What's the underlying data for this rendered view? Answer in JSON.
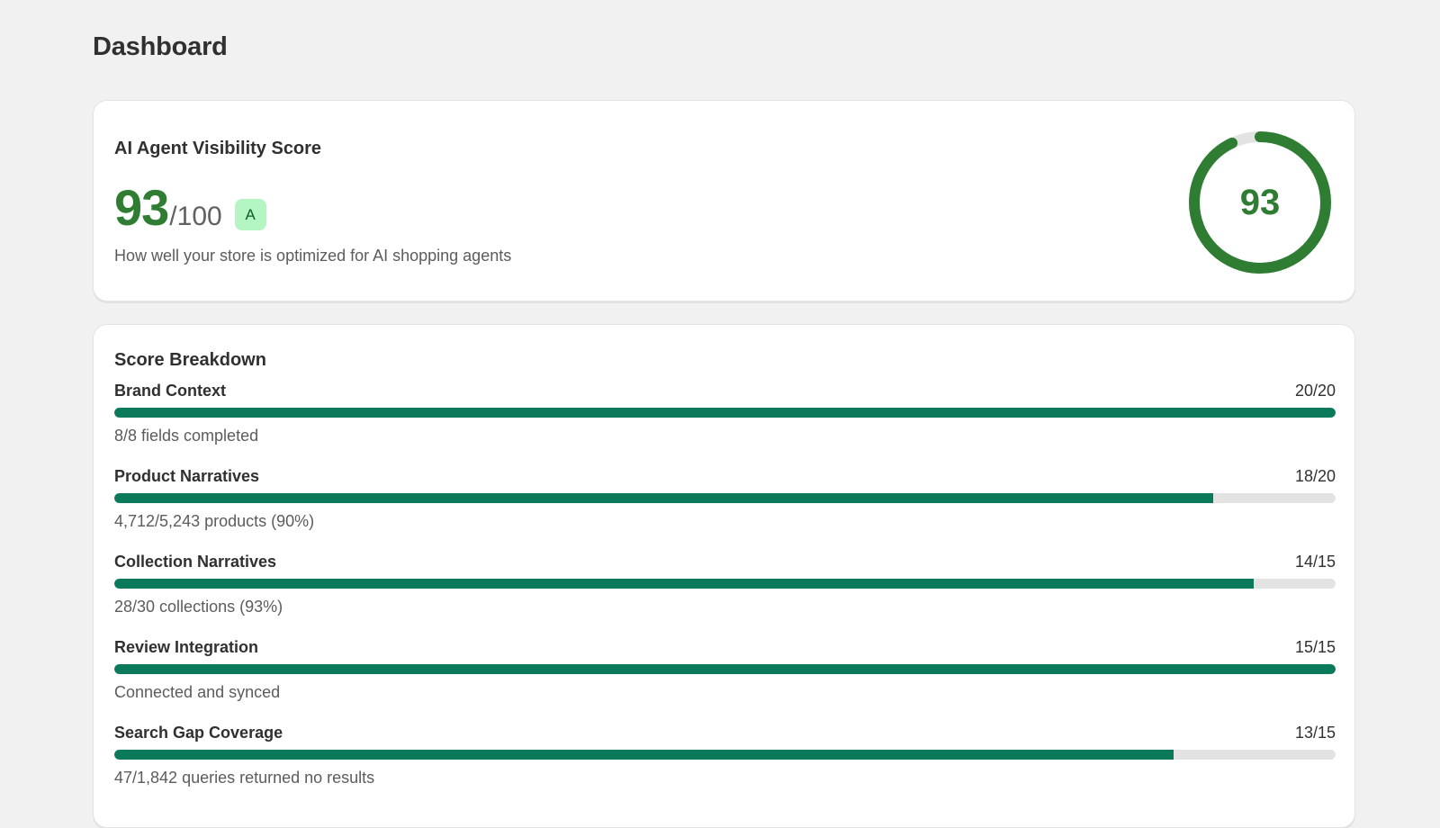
{
  "page": {
    "title": "Dashboard"
  },
  "score_card": {
    "title": "AI Agent Visibility Score",
    "score": "93",
    "max": "/100",
    "grade": "A",
    "description": "How well your store is optimized for AI shopping agents",
    "ring_label": "93",
    "ring_fraction": 0.93,
    "colors": {
      "accent": "#2e7d32",
      "track": "#e3e3e3",
      "badge_bg": "#b4f5c4"
    }
  },
  "breakdown": {
    "title": "Score Breakdown",
    "bar_color": "#0b7a5a",
    "metrics": [
      {
        "name": "Brand Context",
        "score": "20/20",
        "fraction": 1.0,
        "detail": "8/8 fields completed"
      },
      {
        "name": "Product Narratives",
        "score": "18/20",
        "fraction": 0.9,
        "detail": "4,712/5,243 products (90%)"
      },
      {
        "name": "Collection Narratives",
        "score": "14/15",
        "fraction": 0.933,
        "detail": "28/30 collections (93%)"
      },
      {
        "name": "Review Integration",
        "score": "15/15",
        "fraction": 1.0,
        "detail": "Connected and synced"
      },
      {
        "name": "Search Gap Coverage",
        "score": "13/15",
        "fraction": 0.867,
        "detail": "47/1,842 queries returned no results"
      }
    ]
  }
}
